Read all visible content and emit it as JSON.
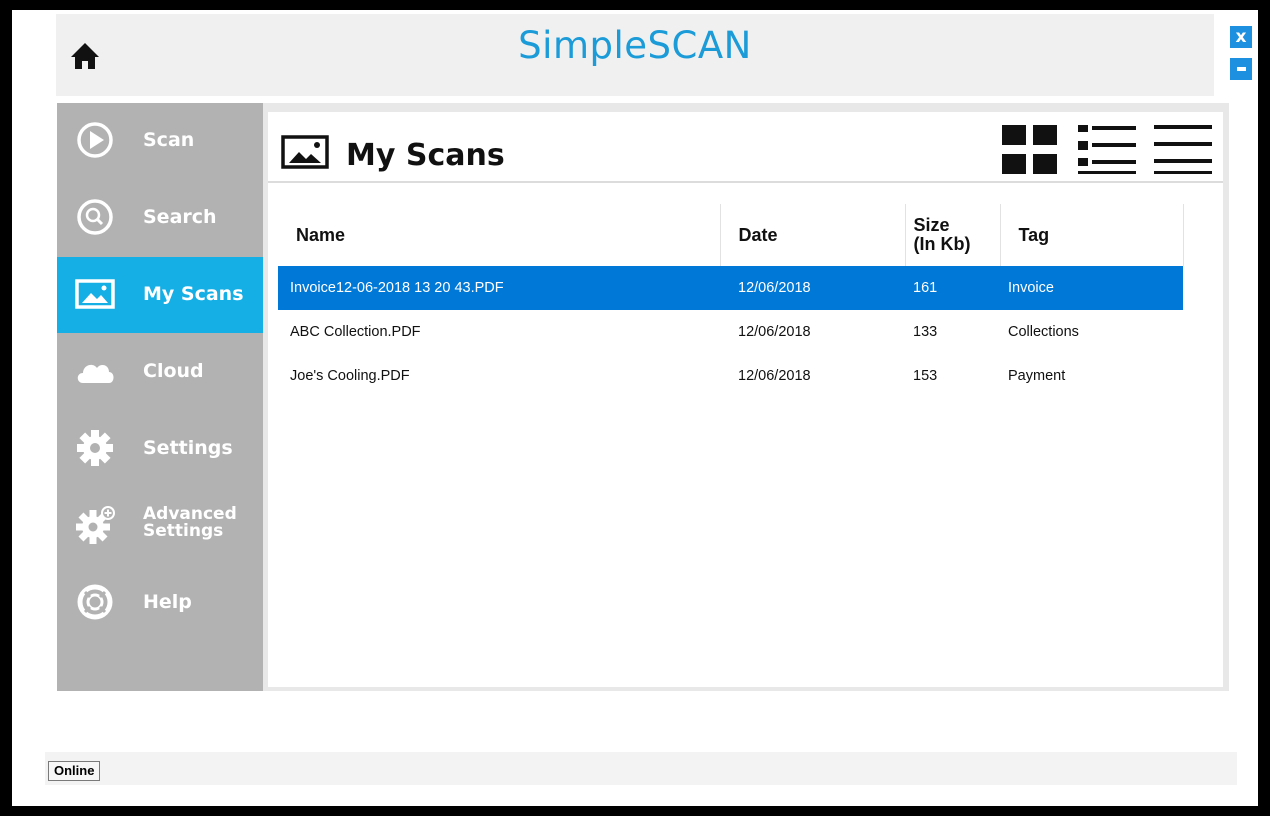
{
  "app": {
    "title": "SimpleSCAN",
    "close_label": "x"
  },
  "sidebar": {
    "items": [
      {
        "label": "Scan",
        "icon": "play-circle-icon",
        "active": false
      },
      {
        "label": "Search",
        "icon": "search-circle-icon",
        "active": false
      },
      {
        "label": "My Scans",
        "icon": "image-icon",
        "active": true
      },
      {
        "label": "Cloud",
        "icon": "cloud-icon",
        "active": false
      },
      {
        "label": "Settings",
        "icon": "gear-icon",
        "active": false
      },
      {
        "label": "Advanced Settings",
        "icon": "gear-plus-icon",
        "active": false
      },
      {
        "label": "Help",
        "icon": "lifebuoy-icon",
        "active": false
      }
    ]
  },
  "panel": {
    "title": "My Scans",
    "title_icon": "image-icon",
    "view_modes": [
      "grid-view-icon",
      "detail-view-icon",
      "list-view-icon"
    ]
  },
  "table": {
    "columns": [
      "Name",
      "Date",
      "Size (In Kb)",
      "Tag"
    ],
    "rows": [
      {
        "name": "Invoice12-06-2018 13 20 43.PDF",
        "date": "12/06/2018",
        "size": "161",
        "tag": "Invoice",
        "selected": true
      },
      {
        "name": "ABC Collection.PDF",
        "date": "12/06/2018",
        "size": "133",
        "tag": "Collections",
        "selected": false
      },
      {
        "name": "Joe's Cooling.PDF",
        "date": "12/06/2018",
        "size": "153",
        "tag": "Payment",
        "selected": false
      }
    ]
  },
  "status": {
    "connection": "Online"
  },
  "colors": {
    "accent": "#15aee5",
    "title": "#1b9bd8",
    "selection": "#0078d7",
    "sidebar": "#b2b2b2"
  }
}
